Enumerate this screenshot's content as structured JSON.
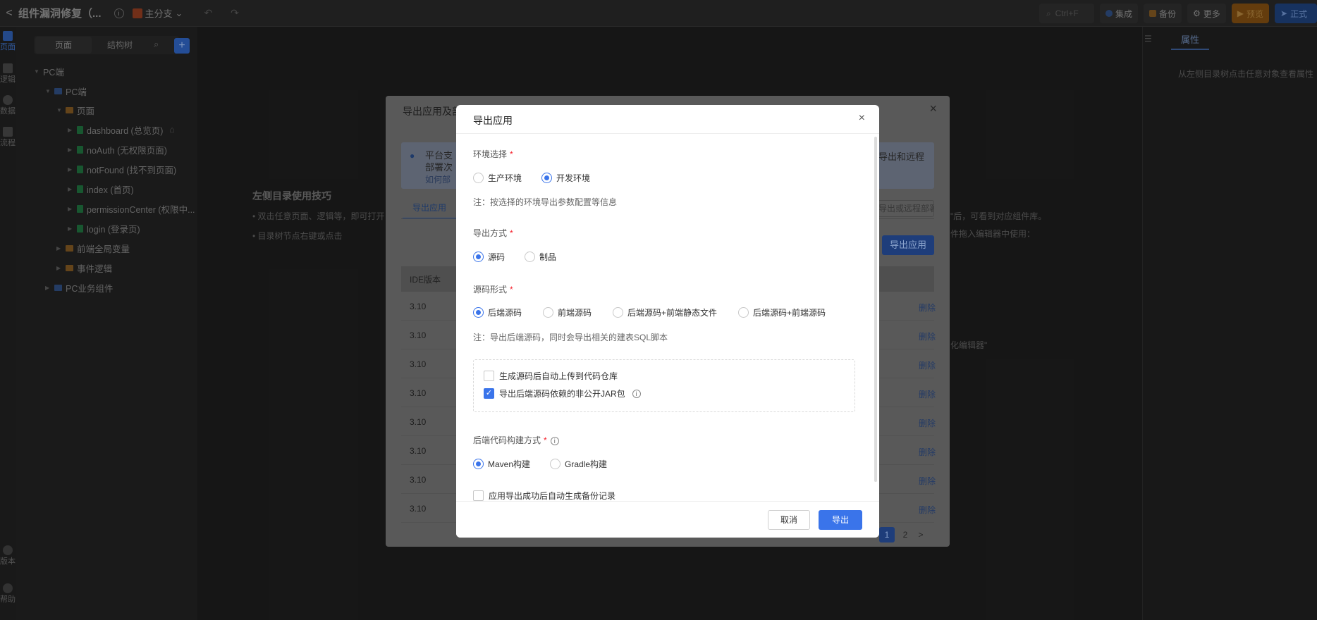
{
  "topbar": {
    "back": "<",
    "title": "组件漏洞修复（...",
    "branch": "主分支",
    "search_placeholder": "Ctrl+F",
    "integrate": "集成",
    "backup": "备份",
    "more": "更多",
    "preview": "预览",
    "publish": "正式"
  },
  "rail": {
    "pages": "页面",
    "logic": "逻辑",
    "data": "数据",
    "flow": "流程",
    "version": "版本",
    "help": "帮助"
  },
  "tree": {
    "tabs": [
      "页面",
      "结构树"
    ],
    "add": "+",
    "nodes": [
      {
        "label": "PC端"
      },
      {
        "label": "PC端"
      },
      {
        "label": "页面"
      },
      {
        "label": "dashboard (总览页)"
      },
      {
        "label": "noAuth (无权限页面)"
      },
      {
        "label": "notFound (找不到页面)"
      },
      {
        "label": "index (首页)"
      },
      {
        "label": "permissionCenter (权限中..."
      },
      {
        "label": "login (登录页)"
      },
      {
        "label": "前端全局变量"
      },
      {
        "label": "事件逻辑"
      },
      {
        "label": "PC业务组件"
      }
    ]
  },
  "canvas": {
    "tips_title": "左侧目录使用技巧",
    "tip1": "• 双击任意页面、逻辑等，即可打开",
    "tip2": "• 目录树节点右键或点击",
    "tip_right1": "\"后，可看到对应组件库。",
    "tip_right2": "件拖入编辑器中使用：",
    "tip_right3": "化编辑器\""
  },
  "properties": {
    "tab": "属性",
    "hint": "从左侧目录树点击任意对象查看属性"
  },
  "bg_dialog": {
    "title": "导出应用及部署",
    "info_line1": "平台支",
    "info_line2": "部署次",
    "info_right": "导出和远程",
    "info_link": "如何部",
    "tab": "导出应用",
    "remote_btn": "导出或远程部署",
    "export_btn": "导出应用",
    "col_ide": "IDE版本",
    "rows": [
      "3.10",
      "3.10",
      "3.10",
      "3.10",
      "3.10",
      "3.10",
      "3.10",
      "3.10"
    ],
    "row_action": "删除",
    "pages": [
      "1",
      "2",
      ">"
    ]
  },
  "dialog": {
    "title": "导出应用",
    "env_label": "环境选择",
    "env_options": [
      "生产环境",
      "开发环境"
    ],
    "env_selected": "开发环境",
    "env_note": "注：按选择的环境导出参数配置等信息",
    "mode_label": "导出方式",
    "mode_options": [
      "源码",
      "制品"
    ],
    "mode_selected": "源码",
    "form_label": "源码形式",
    "form_options": [
      "后端源码",
      "前端源码",
      "后端源码+前端静态文件",
      "后端源码+前端源码"
    ],
    "form_selected": "后端源码",
    "form_note": "注：导出后端源码，同时会导出相关的建表SQL脚本",
    "chk_upload": "生成源码后自动上传到代码仓库",
    "chk_upload_checked": false,
    "chk_jar": "导出后端源码依赖的非公开JAR包",
    "chk_jar_checked": true,
    "build_label": "后端代码构建方式",
    "build_options": [
      "Maven构建",
      "Gradle构建"
    ],
    "build_selected": "Maven构建",
    "chk_backup": "应用导出成功后自动生成备份记录",
    "chk_backup_checked": false,
    "cancel": "取消",
    "ok": "导出",
    "required_mark": "*",
    "close": "×",
    "help_mark": "i"
  },
  "colors": {
    "primary": "#3a74ea",
    "required": "#f5222d"
  }
}
